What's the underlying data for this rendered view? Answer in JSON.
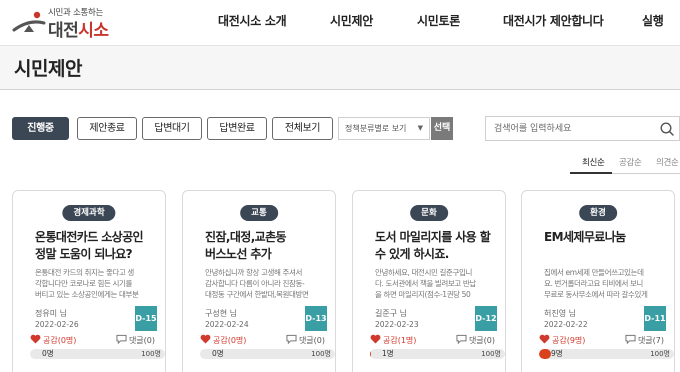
{
  "header": {
    "logo_tagline": "시민과 소통하는",
    "logo_name_a": "대전",
    "logo_name_b": "시소",
    "nav": [
      "대전시소 소개",
      "시민제안",
      "시민토론",
      "대전시가 제안합니다",
      "실행"
    ]
  },
  "page_title": "시민제안",
  "filters": {
    "buttons": [
      "진행중",
      "제안종료",
      "답변대기",
      "답변완료",
      "전체보기"
    ],
    "active_index": 0,
    "category_select": "정책분류별로 보기",
    "select_button": "선택"
  },
  "search": {
    "placeholder": "검색어를 입력하세요",
    "value": ""
  },
  "sort": {
    "options": [
      "최신순",
      "공감순",
      "의견순"
    ],
    "active_index": 0
  },
  "cards": [
    {
      "category": "경제과학",
      "title": "온통대전카드 소상공인 정말 도움이 되나요?",
      "body": "온통대전 카드의 취지는 좋다고 생각합니다만 코로나로 힘든 시기를 버티고 있는 소상공인에게는 대부분 도움이 되",
      "author": "정유미 님",
      "date": "2022-02-26",
      "dday": "D-15",
      "likes": "공감(0명)",
      "comments": "댓글(0)",
      "progress_current": "0명",
      "progress_goal": "100명",
      "progress_fraction": 0
    },
    {
      "category": "교통",
      "title": "진잠,대정,교촌동 버스노선 추가",
      "body": "안녕하십니까 항상 고생해 주셔서 감사합니다 다름이 아니라 진잠동-대정동 구간에서 한밭대,목원대방면으로 가",
      "author": "구성현 님",
      "date": "2022-02-24",
      "dday": "D-13",
      "likes": "공감(0명)",
      "comments": "댓글(0)",
      "progress_current": "0명",
      "progress_goal": "100명",
      "progress_fraction": 0
    },
    {
      "category": "문화",
      "title": "도서 마일리지를 사용 할 수 있게 하시죠.",
      "body": "안녕하세요, 대전시민 길준구입니다. 도서관에서 책을 빌려보고 반납을 하면 마일리지(점수-1권당 50원)를 받게 됩",
      "author": "길준구 님",
      "date": "2022-02-23",
      "dday": "D-12",
      "likes": "공감(1명)",
      "comments": "댓글(0)",
      "progress_current": "1명",
      "progress_goal": "100명",
      "progress_fraction": 0.01
    },
    {
      "category": "환경",
      "title": "EM세제무료나눔",
      "body": "집에서 em세제 만들어쓰고있는데요. 번거롭더라고요 티비에서 보니 무료로 동사무소에서 따라 갈수있게 하는 동",
      "author": "허진영 님",
      "date": "2022-02-22",
      "dday": "D-11",
      "likes": "공감(9명)",
      "comments": "댓글(7)",
      "progress_current": "9명",
      "progress_goal": "100명",
      "progress_fraction": 0.09
    }
  ],
  "colors": {
    "accent_red": "#c8372d",
    "badge_dark": "#3b4754",
    "dday_teal": "#3a9fa5",
    "progress_fill": "#d9421c"
  }
}
